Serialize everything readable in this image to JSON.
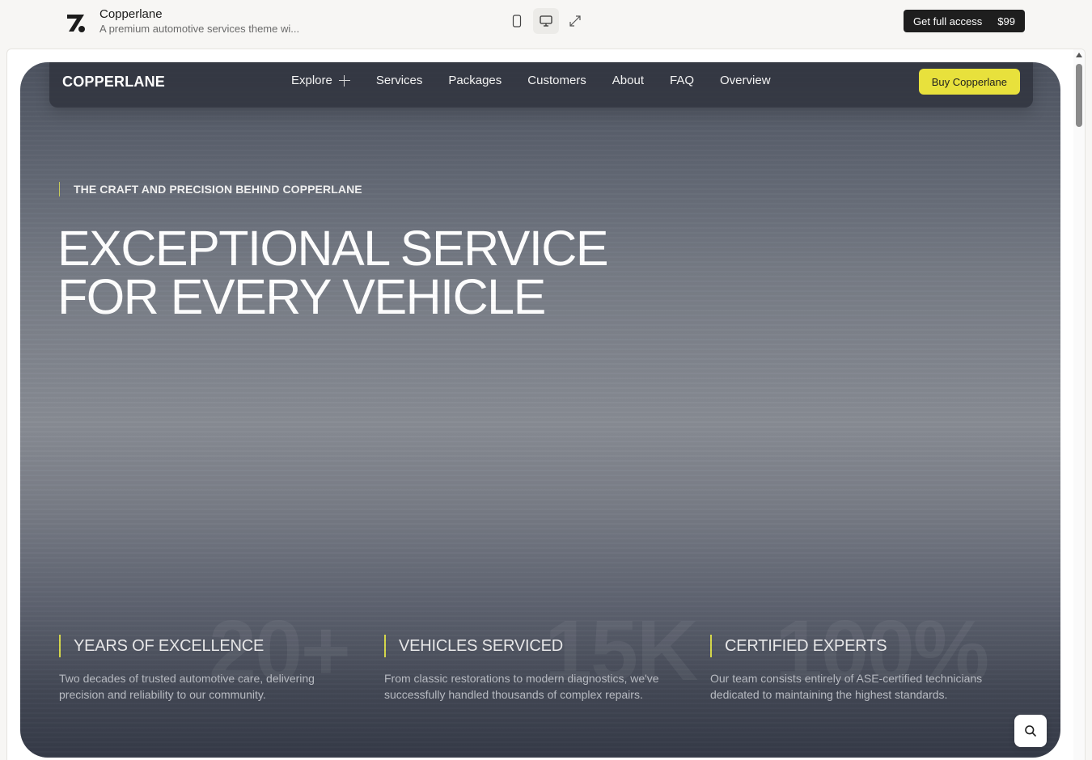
{
  "topbar": {
    "brand_name": "Copperlane",
    "brand_subtitle": "A premium automotive services theme wi...",
    "access_label": "Get full access",
    "access_price": "$99",
    "view_modes": [
      "mobile-icon",
      "desktop-icon",
      "expand-icon"
    ]
  },
  "nav": {
    "logo": "COPPERLANE",
    "links": [
      "Explore",
      "Services",
      "Packages",
      "Customers",
      "About",
      "FAQ",
      "Overview"
    ],
    "cta": "Buy Copperlane"
  },
  "hero": {
    "eyebrow": "THE CRAFT AND PRECISION BEHIND COPPERLANE",
    "headline_line1": "EXCEPTIONAL SERVICE",
    "headline_line2": "FOR EVERY VEHICLE"
  },
  "stats": [
    {
      "big": "20+",
      "title": "YEARS OF EXCELLENCE",
      "desc": "Two decades of trusted automotive care, delivering precision and reliability to our community."
    },
    {
      "big": "15K",
      "title": "VEHICLES SERVICED",
      "desc": "From classic restorations to modern diagnostics, we've successfully handled thousands of complex repairs."
    },
    {
      "big": "100%",
      "title": "CERTIFIED EXPERTS",
      "desc": "Our team consists entirely of ASE-certified technicians dedicated to maintaining the highest standards."
    }
  ],
  "colors": {
    "accent": "#e8e13c",
    "nav_bg": "#30343e",
    "topbar_button": "#1e1e1e"
  }
}
